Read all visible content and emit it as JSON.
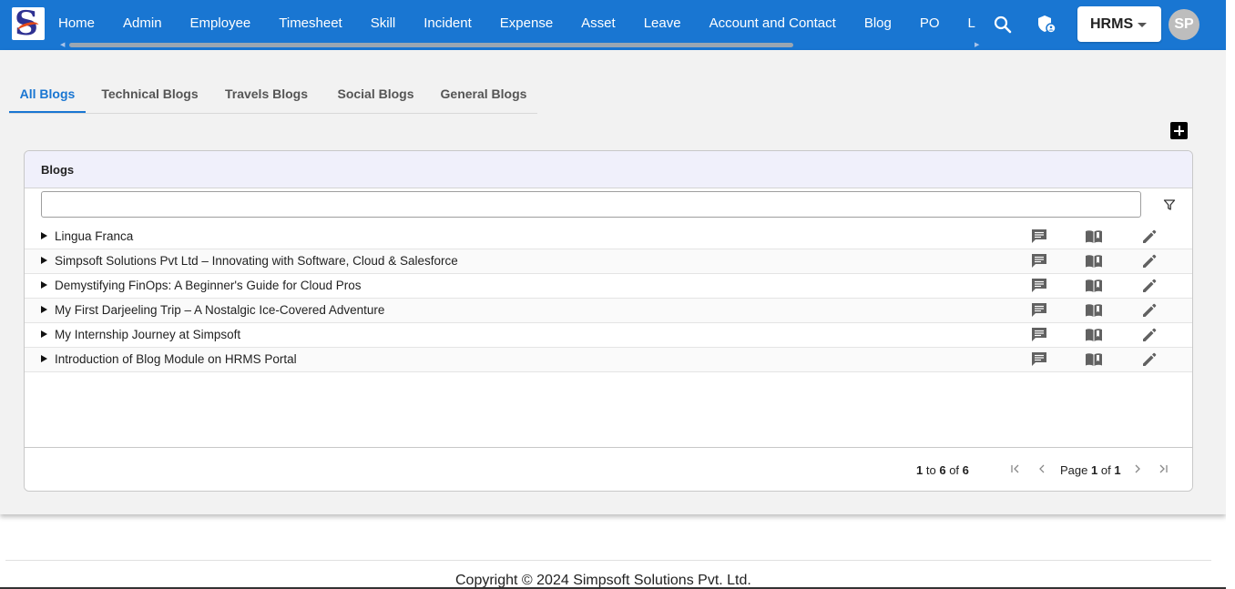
{
  "nav": {
    "items": [
      "Home",
      "Admin",
      "Employee",
      "Timesheet",
      "Skill",
      "Incident",
      "Expense",
      "Asset",
      "Leave",
      "Account and Contact",
      "Blog",
      "PO",
      "L"
    ]
  },
  "header": {
    "app_switcher": "HRMS",
    "avatar_initials": "SP",
    "accent_color": "#1976d2"
  },
  "tabs": [
    "All Blogs",
    "Technical Blogs",
    "Travels Blogs",
    "Social Blogs",
    "General Blogs"
  ],
  "active_tab": "All Blogs",
  "grid": {
    "title": "Blogs",
    "filter_value": "",
    "rows": [
      "Lingua Franca",
      "Simpsoft Solutions Pvt Ltd – Innovating with Software, Cloud & Salesforce",
      "Demystifying FinOps: A Beginner's Guide for Cloud Pros",
      "My First Darjeeling Trip – A Nostalgic Ice-Covered Adventure",
      "My Internship Journey at Simpsoft",
      "Introduction of Blog Module on HRMS Portal"
    ],
    "row_icons": [
      "comment-icon",
      "read-book-icon",
      "edit-pencil-icon"
    ]
  },
  "paging": {
    "from": "1",
    "to_word": "to",
    "to": "6",
    "of_word": "of",
    "total": "6",
    "page_word": "Page",
    "page": "1",
    "page_of_word": "of",
    "page_total": "1"
  },
  "footer": {
    "copyright": "Copyright © 2024 Simpsoft Solutions Pvt. Ltd."
  }
}
